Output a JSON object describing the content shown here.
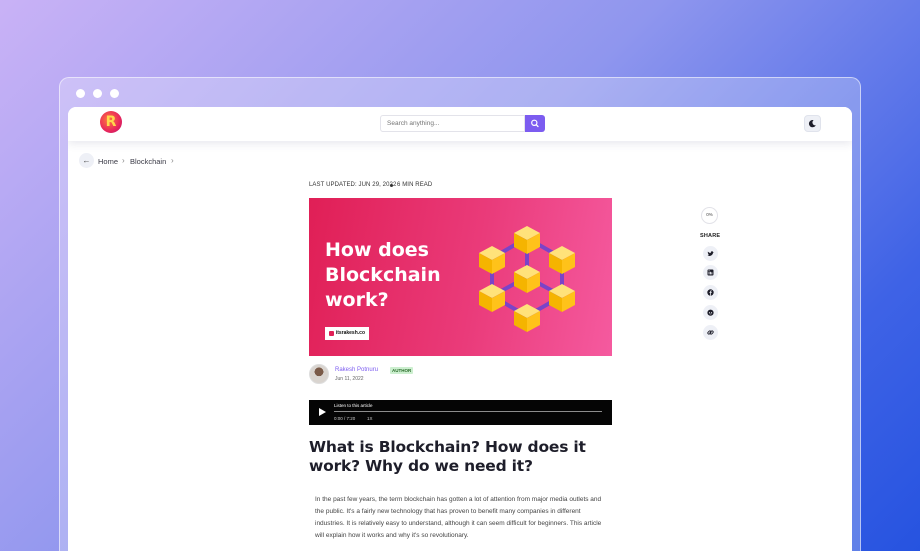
{
  "header": {
    "logo_letter": "R",
    "search_placeholder": "Search anything..."
  },
  "breadcrumb": {
    "items": [
      "Home",
      "Blockchain"
    ],
    "separator": "›"
  },
  "article_meta": {
    "last_updated": "LAST UPDATED: JUN 29, 2022",
    "read_time": "6 MIN READ"
  },
  "hero": {
    "title_lines": [
      "How does",
      "Blockchain",
      "work?"
    ],
    "tag": "itsrakesh.co"
  },
  "author": {
    "name": "Rakesh Potnuru",
    "badge": "AUTHOR",
    "date": "Jun 11, 2022"
  },
  "audio_player": {
    "label": "Listen to this article",
    "time": "0:00 / 7:20",
    "speed": "1X"
  },
  "article": {
    "title": "What is Blockchain? How does it work? Why do we need it?",
    "body": "In the past few years, the term blockchain has gotten a lot of attention from major media outlets and the public. It's a fairly new technology that has proven to benefit many companies in different industries. It is relatively easy to understand, although it can seem difficult for beginners. This article will explain how it works and why it's so revolutionary."
  },
  "sidebar": {
    "progress": "0%",
    "share_label": "SHARE",
    "share_icons": [
      "twitter-icon",
      "linkedin-icon",
      "facebook-icon",
      "reddit-icon",
      "link-icon"
    ]
  },
  "colors": {
    "accent": "#7c5cf0",
    "hero_start": "#e01f56",
    "hero_end": "#f55a9f",
    "cube_face": "#ffc21a",
    "player_bg": "#050505"
  }
}
